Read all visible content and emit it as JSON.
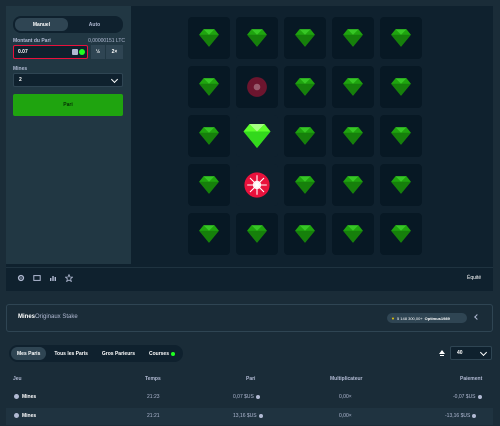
{
  "sidebar": {
    "modes": [
      "Manuel",
      "Auto"
    ],
    "bet_label": "Montant du Pari",
    "bet_btc": "0,00000151 LTC",
    "bet_value": "0.07",
    "half_label": "½",
    "double_label": "2×",
    "mines_label": "Mines",
    "mines_value": "2",
    "play_label": "Pari"
  },
  "board": {
    "grid": "5x5",
    "gem_color": "#1fa40f",
    "gem_highlight_color": "#5eff2d",
    "mine_color": "#e9113c"
  },
  "footer": {
    "icons": [
      "settings-icon",
      "theatre-icon",
      "stats-icon",
      "favorite-icon"
    ],
    "fair_label": "Équité"
  },
  "info": {
    "title": "Mines",
    "subtitle": "Originaux Stake",
    "prize": "5 148 300,00+",
    "winner": "Optimus1989"
  },
  "bets": {
    "tabs": [
      "Mes Paris",
      "Tous les Paris",
      "Gros Parieurs",
      "Courses"
    ],
    "count": "40",
    "columns": [
      "Jeu",
      "Temps",
      "Pari",
      "Multiplicateur",
      "Paiement"
    ],
    "rows": [
      {
        "game": "Mines",
        "time": "21:23",
        "bet": "0,07 $US",
        "multiplier": "0,00×",
        "payout": "-0,07 $US"
      },
      {
        "game": "Mines",
        "time": "21:21",
        "bet": "13,16 $US",
        "multiplier": "0,00×",
        "payout": "-13,16 $US"
      }
    ]
  }
}
